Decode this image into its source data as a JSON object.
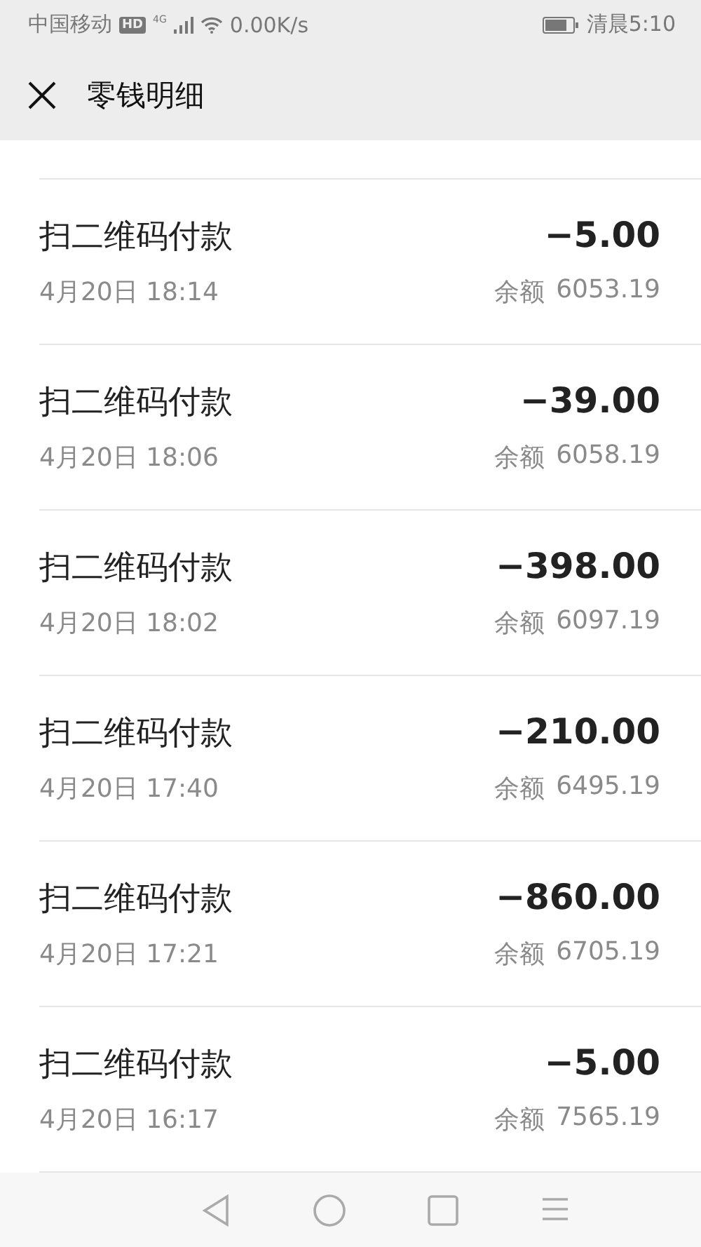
{
  "status_bar": {
    "carrier": "中国移动",
    "hd_badge": "HD",
    "network": "4G",
    "speed": "0.00K/s",
    "time": "清晨5:10"
  },
  "header": {
    "title": "零钱明细"
  },
  "transactions": [
    {
      "title": "扫二维码付款",
      "date": "4月20日 18:14",
      "amount": "−5.00",
      "balance_label": "余额",
      "balance": "6053.19"
    },
    {
      "title": "扫二维码付款",
      "date": "4月20日 18:06",
      "amount": "−39.00",
      "balance_label": "余额",
      "balance": "6058.19"
    },
    {
      "title": "扫二维码付款",
      "date": "4月20日 18:02",
      "amount": "−398.00",
      "balance_label": "余额",
      "balance": "6097.19"
    },
    {
      "title": "扫二维码付款",
      "date": "4月20日 17:40",
      "amount": "−210.00",
      "balance_label": "余额",
      "balance": "6495.19"
    },
    {
      "title": "扫二维码付款",
      "date": "4月20日 17:21",
      "amount": "−860.00",
      "balance_label": "余额",
      "balance": "6705.19"
    },
    {
      "title": "扫二维码付款",
      "date": "4月20日 16:17",
      "amount": "−5.00",
      "balance_label": "余额",
      "balance": "7565.19"
    }
  ]
}
